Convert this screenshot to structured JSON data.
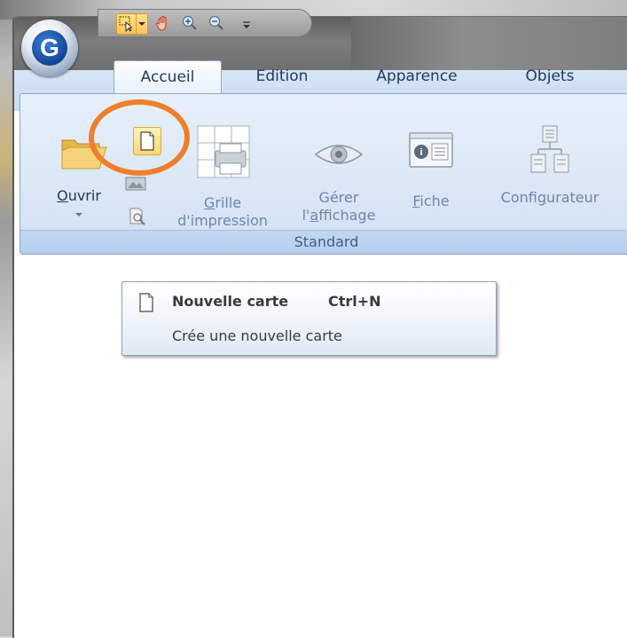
{
  "app": {
    "orb_letter": "G"
  },
  "ribbon": {
    "tabs": [
      {
        "label": "Accueil",
        "active": true
      },
      {
        "label": "Edition",
        "active": false
      },
      {
        "label": "Apparence",
        "active": false
      },
      {
        "label": "Objets",
        "active": false
      }
    ],
    "group_caption": "Standard",
    "buttons": {
      "ouvrir": {
        "label_pre": "",
        "label_underlined": "O",
        "label_post": "uvrir"
      },
      "grille": {
        "line1_underlined": "G",
        "line1_post": "rille",
        "line2": "d'impression"
      },
      "gerer": {
        "line1": "Gérer",
        "line2_pre": "l'",
        "line2_underlined": "a",
        "line2_post": "ffichage"
      },
      "fiche": {
        "label_underlined": "F",
        "label_post": "iche"
      },
      "configurateur": {
        "label_pre": "Confi",
        "label_underlined": "g",
        "label_post": "urateur"
      }
    }
  },
  "tooltip": {
    "title": "Nouvelle carte",
    "shortcut": "Ctrl+N",
    "description": "Crée une nouvelle carte"
  },
  "colors": {
    "highlight": "#f07e2a",
    "ribbon_text": "#1e395b"
  }
}
